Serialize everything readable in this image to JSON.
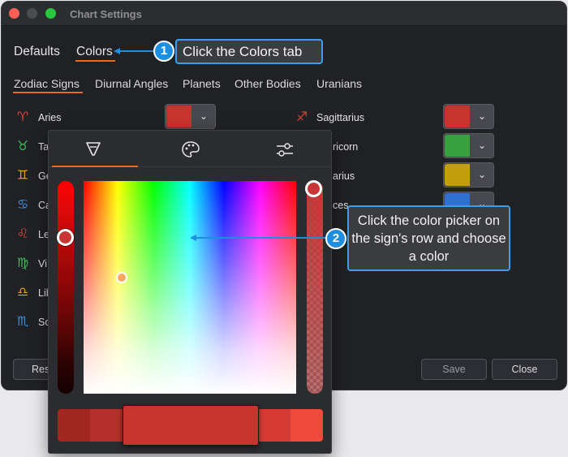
{
  "window": {
    "title": "Chart Settings"
  },
  "tabs": {
    "defaults": "Defaults",
    "colors": "Colors"
  },
  "subtabs": {
    "zodiac": "Zodiac Signs",
    "diurnal": "Diurnal Angles",
    "planets": "Planets",
    "other": "Other Bodies",
    "uranians": "Uranians"
  },
  "signs_left": [
    {
      "glyph": "♈",
      "label": "Aries",
      "icon": "aries-icon",
      "color": "#e0433a"
    },
    {
      "glyph": "♉",
      "label": "Ta",
      "icon": "taurus-icon",
      "color": "#3cbf5a"
    },
    {
      "glyph": "♊",
      "label": "Ge",
      "icon": "gemini-icon",
      "color": "#e3a11c"
    },
    {
      "glyph": "♋",
      "label": "Ca",
      "icon": "cancer-icon",
      "color": "#3b8ee0"
    },
    {
      "glyph": "♌",
      "label": "Le",
      "icon": "leo-icon",
      "color": "#e0433a"
    },
    {
      "glyph": "♍",
      "label": "Vi",
      "icon": "virgo-icon",
      "color": "#3cbf5a"
    },
    {
      "glyph": "♎",
      "label": "Lib",
      "icon": "libra-icon",
      "color": "#e3a11c"
    },
    {
      "glyph": "♏",
      "label": "Sc",
      "icon": "scorpio-icon",
      "color": "#3b8ee0"
    }
  ],
  "signs_right": [
    {
      "glyph": "♐",
      "label": "Sagittarius",
      "icon": "sagittarius-icon",
      "color": "#e0433a",
      "swatch": "#c7342d"
    },
    {
      "glyph": "♑",
      "label": "ricorn",
      "icon": "capricorn-icon",
      "color": "#3cbf5a",
      "swatch": "#36a13d"
    },
    {
      "glyph": "♒",
      "label": "arius",
      "icon": "aquarius-icon",
      "color": "#e3a11c",
      "swatch": "#c39f0d"
    },
    {
      "glyph": "♓",
      "label": "ces",
      "icon": "pisces-icon",
      "color": "#3b8ee0",
      "swatch": "#2f6fd0"
    }
  ],
  "aries_swatch": "#c7342d",
  "chevron": "⌄",
  "buttons": {
    "reset": "Res",
    "save": "Save",
    "close": "Close"
  },
  "picker": {
    "tabs": [
      "fill-bucket-icon",
      "palette-icon",
      "sliders-icon"
    ],
    "selected_color": "#c7342d",
    "palette": [
      "#a1271f",
      "#b5302a",
      "#c7342d",
      "#d63a35",
      "#f04a3c"
    ]
  },
  "callouts": {
    "step1": {
      "number": "1",
      "text": "Click the Colors tab"
    },
    "step2": {
      "number": "2",
      "text": "Click the color picker on the sign's row and choose a color"
    }
  }
}
